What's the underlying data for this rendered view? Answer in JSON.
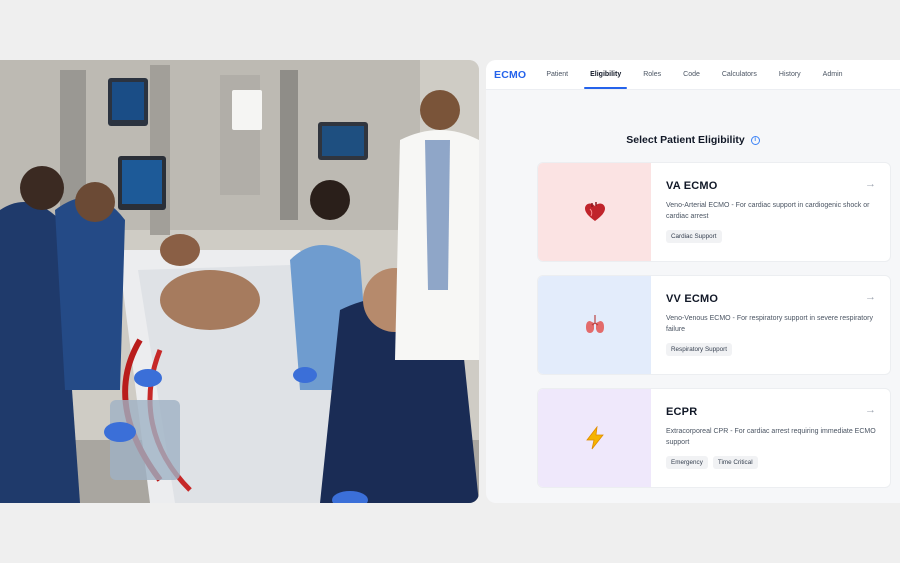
{
  "photo": {
    "alt_kind": "photo",
    "icon": "ecmo-procedure-photo"
  },
  "nav": {
    "brand": "ECMO",
    "tabs": [
      {
        "label": "Patient",
        "active": false
      },
      {
        "label": "Eligibility",
        "active": true
      },
      {
        "label": "Roles",
        "active": false
      },
      {
        "label": "Code",
        "active": false
      },
      {
        "label": "Calculators",
        "active": false
      },
      {
        "label": "History",
        "active": false
      },
      {
        "label": "Admin",
        "active": false
      }
    ]
  },
  "page": {
    "title": "Select Patient Eligibility",
    "info_icon_glyph": "i"
  },
  "cards": [
    {
      "title": "VA ECMO",
      "description": "Veno-Arterial ECMO - For cardiac support in cardiogenic shock or cardiac arrest",
      "tags": [
        "Cardiac Support"
      ],
      "icon": "heart-icon",
      "media_color": "#fbe3e3"
    },
    {
      "title": "VV ECMO",
      "description": "Veno-Venous ECMO - For respiratory support in severe respiratory failure",
      "tags": [
        "Respiratory Support"
      ],
      "icon": "lungs-icon",
      "media_color": "#e3ecfb"
    },
    {
      "title": "ECPR",
      "description": "Extracorporeal CPR - For cardiac arrest requiring immediate ECMO support",
      "tags": [
        "Emergency",
        "Time Critical"
      ],
      "icon": "lightning-icon",
      "media_color": "#efe8fb"
    }
  ],
  "colors": {
    "accent": "#2563eb",
    "page_bg": "#efefef",
    "panel_bg": "#f6f7f9"
  },
  "arrow_glyph": "→"
}
